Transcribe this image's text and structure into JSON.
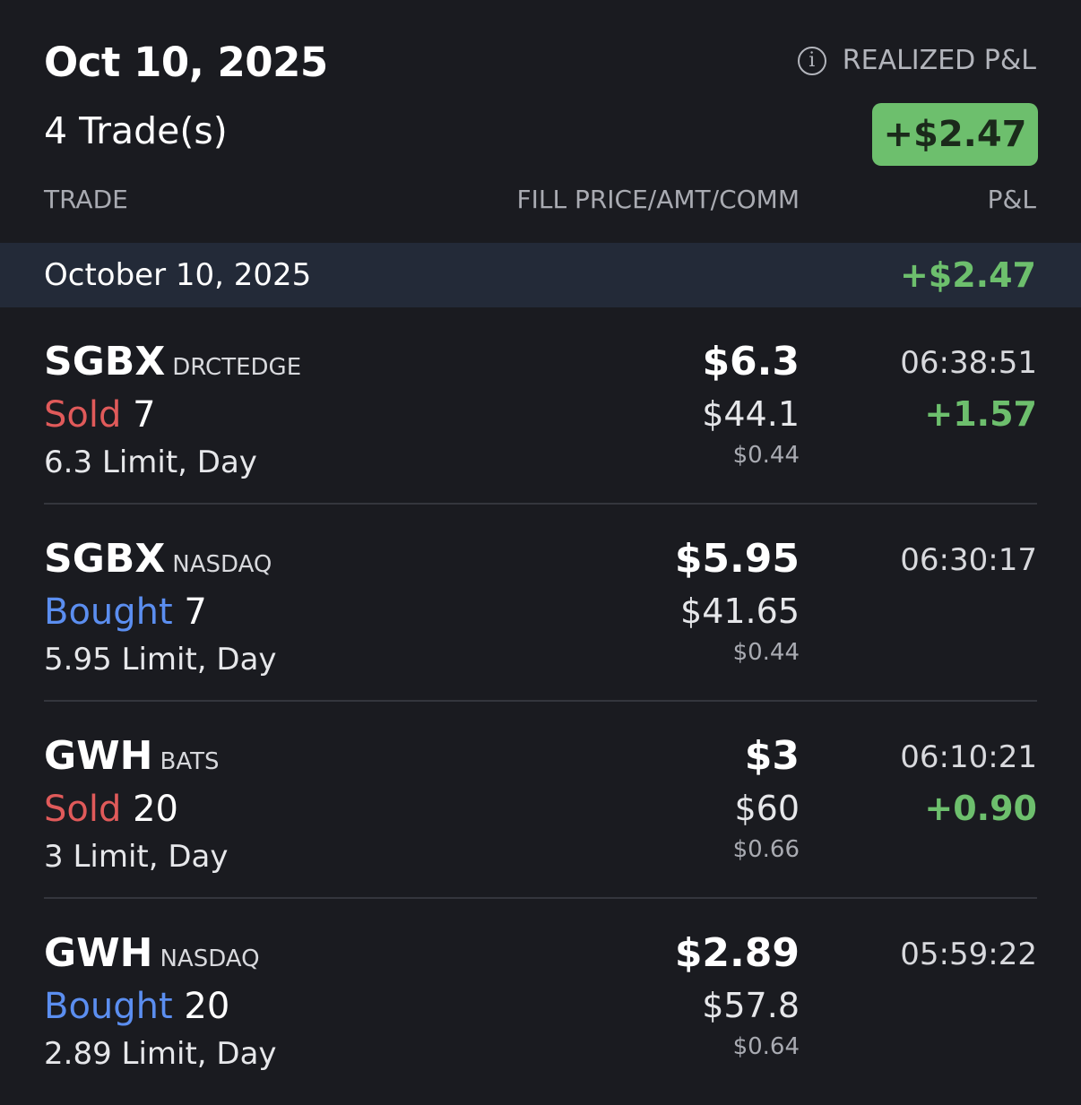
{
  "header": {
    "date": "Oct 10, 2025",
    "trade_count": "4 Trade(s)",
    "realized_label": "REALIZED P&L",
    "info_icon": "info-icon",
    "realized_pnl": "+$2.47",
    "badge_color": "#6dbf6d"
  },
  "columns": {
    "trade": "TRADE",
    "fill": "FILL PRICE/AMT/COMM",
    "pnl": "P&L"
  },
  "day": {
    "label": "October 10, 2025",
    "pnl": "+$2.47"
  },
  "colors": {
    "sold": "#e05a5a",
    "bought": "#5b8ef0",
    "profit": "#6dbf6d"
  },
  "trades": [
    {
      "symbol": "SGBX",
      "exchange": "DRCTEDGE",
      "side": "Sold",
      "qty": "7",
      "order": "6.3 Limit, Day",
      "price": "$6.3",
      "amount": "$44.1",
      "commission": "$0.44",
      "time": "06:38:51",
      "pnl": "+1.57"
    },
    {
      "symbol": "SGBX",
      "exchange": "NASDAQ",
      "side": "Bought",
      "qty": "7",
      "order": "5.95 Limit, Day",
      "price": "$5.95",
      "amount": "$41.65",
      "commission": "$0.44",
      "time": "06:30:17",
      "pnl": ""
    },
    {
      "symbol": "GWH",
      "exchange": "BATS",
      "side": "Sold",
      "qty": "20",
      "order": "3 Limit, Day",
      "price": "$3",
      "amount": "$60",
      "commission": "$0.66",
      "time": "06:10:21",
      "pnl": "+0.90"
    },
    {
      "symbol": "GWH",
      "exchange": "NASDAQ",
      "side": "Bought",
      "qty": "20",
      "order": "2.89 Limit, Day",
      "price": "$2.89",
      "amount": "$57.8",
      "commission": "$0.64",
      "time": "05:59:22",
      "pnl": ""
    }
  ]
}
